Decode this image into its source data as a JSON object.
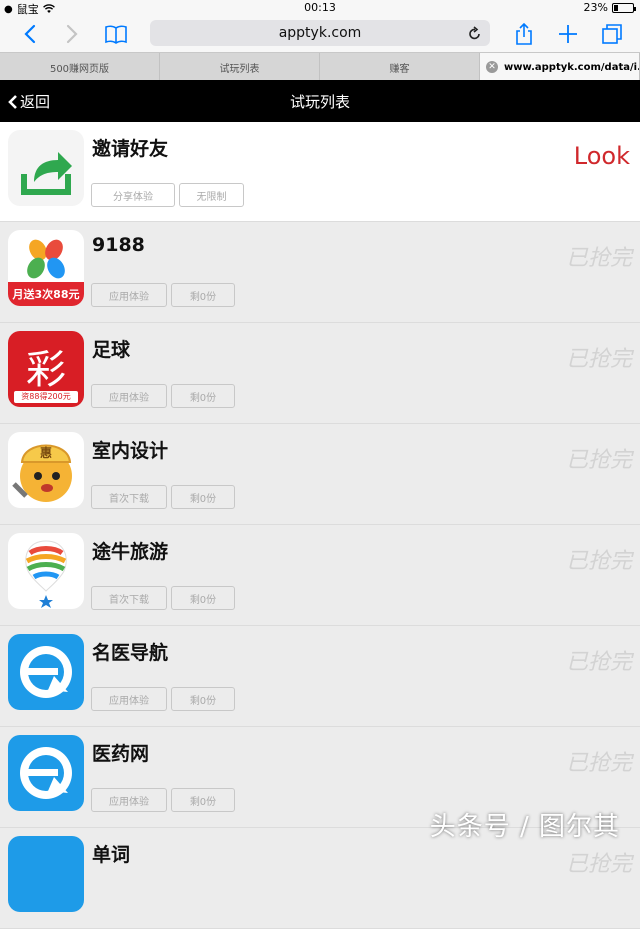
{
  "status_bar": {
    "carrier": "鼠宝",
    "time": "00:13",
    "battery": "23%",
    "battery_level": 0.23
  },
  "browser": {
    "url": "apptyk.com"
  },
  "tabs": [
    {
      "label": "500赚网页版"
    },
    {
      "label": "试玩列表"
    },
    {
      "label": "赚客"
    },
    {
      "label": "www.apptyk.com/data/i..."
    }
  ],
  "header": {
    "back_label": "返回",
    "title": "试玩列表"
  },
  "invite": {
    "name": "邀请好友",
    "tag1": "分享体验",
    "tag2": "无限制",
    "action": "Look"
  },
  "apps": [
    {
      "name": "9188",
      "tag1": "应用体验",
      "tag2": "剩0份",
      "status": "已抢完",
      "banner": "月送3次88元"
    },
    {
      "name": "足球",
      "tag1": "应用体验",
      "tag2": "剩0份",
      "status": "已抢完",
      "glyph": "彩",
      "banner": "资88得200元"
    },
    {
      "name": "室内设计",
      "tag1": "首次下载",
      "tag2": "剩0份",
      "status": "已抢完",
      "glyph": "惠"
    },
    {
      "name": "途牛旅游",
      "tag1": "首次下载",
      "tag2": "剩0份",
      "status": "已抢完"
    },
    {
      "name": "名医导航",
      "tag1": "应用体验",
      "tag2": "剩0份",
      "status": "已抢完"
    },
    {
      "name": "医药网",
      "tag1": "应用体验",
      "tag2": "剩0份",
      "status": "已抢完"
    },
    {
      "name": "单词",
      "tag1": "",
      "tag2": "",
      "status": "已抢完"
    }
  ],
  "watermark": "头条号 / 图尔其",
  "colors": {
    "accent": "#007aff",
    "header_bg": "#000000",
    "look_red": "#d0282c"
  }
}
